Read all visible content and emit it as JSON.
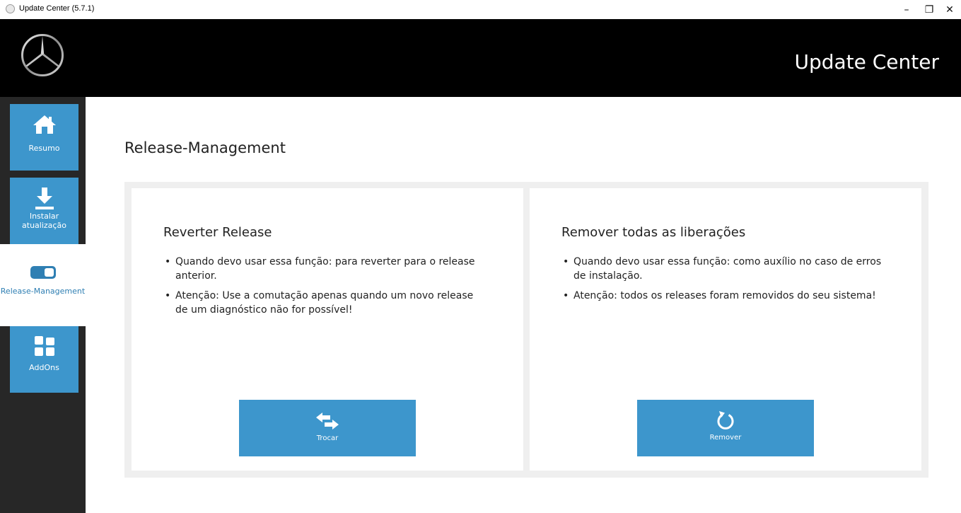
{
  "window": {
    "title": "Update Center (5.7.1)",
    "minimize_glyph": "–",
    "maximize_glyph": "❐",
    "close_glyph": "✕"
  },
  "header": {
    "app_title": "Update Center",
    "logo_icon": "mercedes-star-logo"
  },
  "sidebar": {
    "items": [
      {
        "label": "Resumo",
        "icon": "home-icon",
        "active": false
      },
      {
        "label": "Instalar atualização",
        "icon": "download-icon",
        "active": false
      },
      {
        "label": "Release-Management",
        "icon": "toggle-icon",
        "active": true
      },
      {
        "label": "AddOns",
        "icon": "grid-icon",
        "active": false
      }
    ]
  },
  "main": {
    "page_title": "Release-Management",
    "cards": [
      {
        "title": "Reverter Release",
        "bullets": [
          "Quando devo usar essa função: para reverter para o release anterior.",
          "Atenção: Use a comutação apenas quando um novo release de um diagnóstico não for possível!"
        ],
        "button_label": "Trocar",
        "button_icon": "swap-arrows-icon"
      },
      {
        "title": "Remover todas as liberações",
        "bullets": [
          "Quando devo usar essa função: como auxílio no caso de erros de instalação.",
          "Atenção: todos os releases foram removidos do seu sistema!"
        ],
        "button_label": "Remover",
        "button_icon": "reset-icon"
      }
    ]
  },
  "colors": {
    "accent": "#3d96cc",
    "header_bg": "#000000",
    "sidebar_bg": "#272727",
    "panel_bg": "#efefef"
  }
}
